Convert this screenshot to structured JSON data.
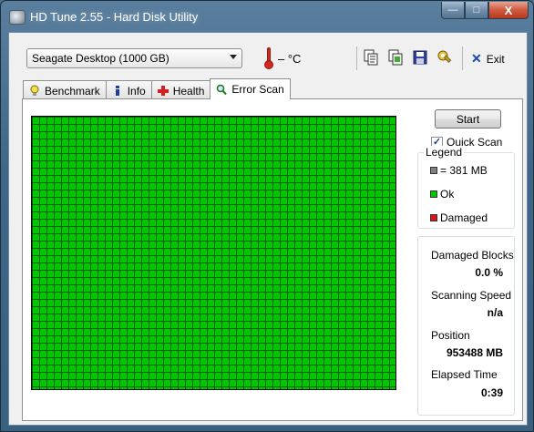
{
  "window": {
    "title": "HD Tune 2.55 - Hard Disk Utility",
    "caption_buttons": {
      "minimize": "—",
      "maximize": "□",
      "close": "X"
    }
  },
  "toolbar": {
    "drive": "Seagate Desktop (1000 GB)",
    "temperature": "– °C",
    "icons": [
      "copy-text-icon",
      "copy-screenshot-icon",
      "save-icon",
      "options-icon"
    ],
    "exit_label": "Exit"
  },
  "tabs": [
    {
      "label": "Benchmark",
      "icon": "bulb-icon",
      "active": false
    },
    {
      "label": "Info",
      "icon": "info-icon",
      "active": false
    },
    {
      "label": "Health",
      "icon": "health-cross-icon",
      "active": false
    },
    {
      "label": "Error Scan",
      "icon": "magnifier-icon",
      "active": true
    }
  ],
  "error_scan": {
    "start_label": "Start",
    "quick_scan_label": "Quick Scan",
    "quick_scan_checked": true,
    "legend": {
      "title": "Legend",
      "block_size": "= 381 MB",
      "ok": "Ok",
      "damaged": "Damaged",
      "colors": {
        "block": "#808080",
        "ok": "#00c800",
        "damaged": "#d81818"
      }
    },
    "stats": {
      "damaged_blocks_label": "Damaged Blocks",
      "damaged_blocks_value": "0.0 %",
      "scanning_speed_label": "Scanning Speed",
      "scanning_speed_value": "n/a",
      "position_label": "Position",
      "position_value": "953488 MB",
      "elapsed_time_label": "Elapsed Time",
      "elapsed_time_value": "0:39"
    },
    "grid_status": "ok"
  }
}
